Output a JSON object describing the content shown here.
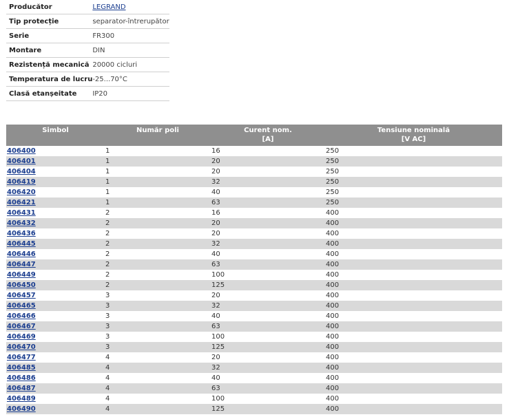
{
  "specs": [
    {
      "label": "Producător",
      "value": "LEGRAND",
      "link": true
    },
    {
      "label": "Tip protecție",
      "value": "separator-întrerupător"
    },
    {
      "label": "Serie",
      "value": "FR300"
    },
    {
      "label": "Montare",
      "value": "DIN"
    },
    {
      "label": "Rezistență mecanică",
      "value": "20000 cicluri"
    },
    {
      "label": "Temperatura de lucru",
      "value": "-25...70°C"
    },
    {
      "label": "Clasă etanșeitate",
      "value": "IP20"
    }
  ],
  "table": {
    "headers": {
      "symbol": "Simbol",
      "poles": "Număr poli",
      "current": "Curent nom.",
      "current_unit": "[A]",
      "voltage": "Tensiune nominală",
      "voltage_unit": "[V AC]"
    },
    "rows": [
      {
        "symbol": "406400",
        "poles": "1",
        "current": "16",
        "voltage": "250"
      },
      {
        "symbol": "406401",
        "poles": "1",
        "current": "20",
        "voltage": "250"
      },
      {
        "symbol": "406404",
        "poles": "1",
        "current": "20",
        "voltage": "250"
      },
      {
        "symbol": "406419",
        "poles": "1",
        "current": "32",
        "voltage": "250"
      },
      {
        "symbol": "406420",
        "poles": "1",
        "current": "40",
        "voltage": "250"
      },
      {
        "symbol": "406421",
        "poles": "1",
        "current": "63",
        "voltage": "250"
      },
      {
        "symbol": "406431",
        "poles": "2",
        "current": "16",
        "voltage": "400"
      },
      {
        "symbol": "406432",
        "poles": "2",
        "current": "20",
        "voltage": "400"
      },
      {
        "symbol": "406436",
        "poles": "2",
        "current": "20",
        "voltage": "400"
      },
      {
        "symbol": "406445",
        "poles": "2",
        "current": "32",
        "voltage": "400"
      },
      {
        "symbol": "406446",
        "poles": "2",
        "current": "40",
        "voltage": "400"
      },
      {
        "symbol": "406447",
        "poles": "2",
        "current": "63",
        "voltage": "400"
      },
      {
        "symbol": "406449",
        "poles": "2",
        "current": "100",
        "voltage": "400"
      },
      {
        "symbol": "406450",
        "poles": "2",
        "current": "125",
        "voltage": "400"
      },
      {
        "symbol": "406457",
        "poles": "3",
        "current": "20",
        "voltage": "400"
      },
      {
        "symbol": "406465",
        "poles": "3",
        "current": "32",
        "voltage": "400"
      },
      {
        "symbol": "406466",
        "poles": "3",
        "current": "40",
        "voltage": "400"
      },
      {
        "symbol": "406467",
        "poles": "3",
        "current": "63",
        "voltage": "400"
      },
      {
        "symbol": "406469",
        "poles": "3",
        "current": "100",
        "voltage": "400"
      },
      {
        "symbol": "406470",
        "poles": "3",
        "current": "125",
        "voltage": "400"
      },
      {
        "symbol": "406477",
        "poles": "4",
        "current": "20",
        "voltage": "400"
      },
      {
        "symbol": "406485",
        "poles": "4",
        "current": "32",
        "voltage": "400"
      },
      {
        "symbol": "406486",
        "poles": "4",
        "current": "40",
        "voltage": "400"
      },
      {
        "symbol": "406487",
        "poles": "4",
        "current": "63",
        "voltage": "400"
      },
      {
        "symbol": "406489",
        "poles": "4",
        "current": "100",
        "voltage": "400"
      },
      {
        "symbol": "406490",
        "poles": "4",
        "current": "125",
        "voltage": "400"
      }
    ]
  }
}
